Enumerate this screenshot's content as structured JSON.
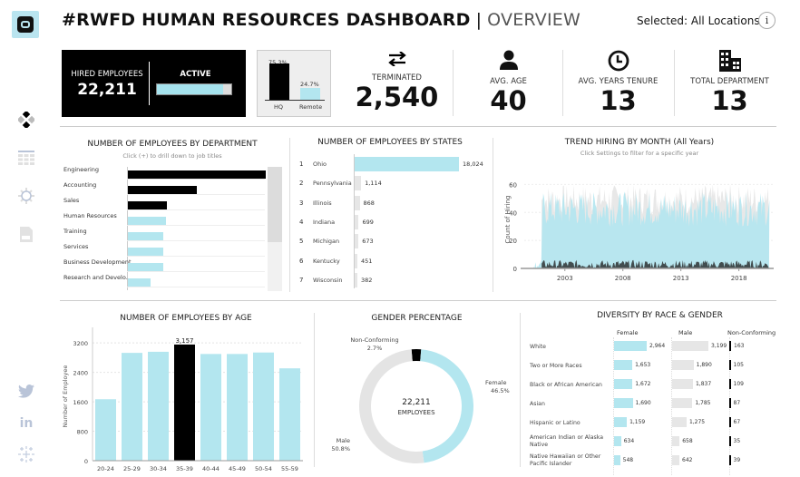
{
  "header": {
    "title": "#RWFD HUMAN RESOURCES DASHBOARD",
    "separator": "|",
    "subtitle": "OVERVIEW",
    "selected": "Selected: All Locations",
    "info_label": "i"
  },
  "sidebar": {
    "logo": "tableau-public-logo-icon",
    "items": [
      {
        "icon": "dashboard-icon",
        "active": true
      },
      {
        "icon": "table-icon",
        "active": false
      },
      {
        "icon": "settings-icon",
        "active": false
      },
      {
        "icon": "pdf-icon",
        "active": false
      }
    ],
    "social": [
      "twitter-icon",
      "linkedin-icon",
      "tableau-icon"
    ]
  },
  "kpis": {
    "hired": {
      "label": "HIRED EMPLOYEES",
      "value": "22,211"
    },
    "active": {
      "label": "ACTIVE",
      "fraction": 0.89
    },
    "location_split": {
      "hq_label": "HQ",
      "hq_pct": "75.3%",
      "hq_value": 75.3,
      "remote_label": "Remote",
      "remote_pct": "24.7%",
      "remote_value": 24.7
    },
    "terminated": {
      "label": "TERMINATED",
      "value": "2,540"
    },
    "avg_age": {
      "label": "AVG. AGE",
      "value": "40"
    },
    "avg_tenure": {
      "label": "AVG. YEARS TENURE",
      "value": "13"
    },
    "total_department": {
      "label": "TOTAL DEPARTMENT",
      "value": "13"
    }
  },
  "colors": {
    "accent": "#b3e6ef",
    "highlight": "#000000",
    "neutral": "#e4e4e4",
    "dark_series": "#3b4446"
  },
  "chart_data": [
    {
      "id": "dept",
      "type": "bar",
      "title": "NUMBER OF EMPLOYEES BY DEPARTMENT",
      "subtitle": "Click (+) to drill down to job titles",
      "categories": [
        "Engineering",
        "Accounting",
        "Sales",
        "Human Resources",
        "Training",
        "Services",
        "Business Development",
        "Research and Develo.."
      ],
      "values": [
        6700,
        3350,
        1900,
        1850,
        1720,
        1720,
        1700,
        1100
      ],
      "highlighted": [
        true,
        true,
        true,
        false,
        false,
        false,
        false,
        false
      ],
      "xlim": [
        0,
        6700
      ]
    },
    {
      "id": "states",
      "type": "bar",
      "title": "NUMBER OF EMPLOYEES BY STATES",
      "ranks": [
        "1",
        "2",
        "3",
        "4",
        "5",
        "6",
        "7"
      ],
      "categories": [
        "Ohio",
        "Pennsylvania",
        "Illinois",
        "Indiana",
        "Michigan",
        "Kentucky",
        "Wisconsin"
      ],
      "values": [
        18024,
        1114,
        868,
        699,
        673,
        451,
        382
      ],
      "labels": [
        "18,024",
        "1,114",
        "868",
        "699",
        "673",
        "451",
        "382"
      ]
    },
    {
      "id": "trend",
      "type": "area",
      "title": "TREND HIRING BY MONTH (All Years)",
      "subtitle": "Click Settings to filter for a specific year",
      "ylabel": "Count of Hiring",
      "xlabel": "",
      "xticks": [
        "2003",
        "2008",
        "2013",
        "2018"
      ],
      "yticks": [
        "0",
        "20",
        "40",
        "60"
      ],
      "ylim": [
        0,
        70
      ],
      "xlim": [
        1999.5,
        2021
      ],
      "series": [
        {
          "name": "Total hires",
          "color": "#e6e6e6",
          "x_start": 2001.0,
          "x_end": 2020.6,
          "typical_range": [
            38,
            60
          ],
          "peak": 68
        },
        {
          "name": "Active hires",
          "color": "#b3e6ef",
          "x_start": 2000.3,
          "x_end": 2020.6,
          "typical_range": [
            30,
            55
          ],
          "peak": 64
        },
        {
          "name": "Terminated hires",
          "color": "#3b4446",
          "x_start": 2001.0,
          "x_end": 2020.6,
          "typical_range": [
            0,
            6
          ],
          "peak": 7
        }
      ]
    },
    {
      "id": "age",
      "type": "bar",
      "title": "NUMBER OF EMPLOYEES BY AGE",
      "ylabel": "Number of Employee",
      "categories": [
        "20-24",
        "25-29",
        "30-34",
        "35-39",
        "40-44",
        "45-49",
        "50-54",
        "55-59"
      ],
      "values": [
        1670,
        2930,
        2960,
        3157,
        2900,
        2900,
        2940,
        2510
      ],
      "highlighted": [
        false,
        false,
        false,
        true,
        false,
        false,
        false,
        false
      ],
      "data_labels": [
        "",
        "",
        "",
        "3,157",
        "",
        "",
        "",
        ""
      ],
      "yticks": [
        "0",
        "800",
        "1600",
        "2400",
        "3200"
      ],
      "ylim": [
        0,
        3500
      ]
    },
    {
      "id": "gender",
      "type": "pie",
      "title": "GENDER PERCENTAGE",
      "center_value": "22,211",
      "center_label": "EMPLOYEES",
      "slices": [
        {
          "name": "Female",
          "value": 46.5,
          "label": "46.5%",
          "color": "#b3e6ef"
        },
        {
          "name": "Male",
          "value": 50.8,
          "label": "50.8%",
          "color": "#e4e4e4"
        },
        {
          "name": "Non-Conforming",
          "value": 2.7,
          "label": "2.7%",
          "color": "#000000"
        }
      ]
    },
    {
      "id": "diversity",
      "type": "table",
      "title": "DIVERSITY BY RACE & GENDER",
      "columns": [
        "Female",
        "Male",
        "Non-Conforming"
      ],
      "rows": [
        {
          "race": "White",
          "female": 2964,
          "male": 3199,
          "nc": 163,
          "female_label": "2,964",
          "male_label": "3,199",
          "nc_label": "163"
        },
        {
          "race": "Two or More Races",
          "female": 1653,
          "male": 1890,
          "nc": 105,
          "female_label": "1,653",
          "male_label": "1,890",
          "nc_label": "105"
        },
        {
          "race": "Black or African American",
          "female": 1672,
          "male": 1837,
          "nc": 109,
          "female_label": "1,672",
          "male_label": "1,837",
          "nc_label": "109"
        },
        {
          "race": "Asian",
          "female": 1690,
          "male": 1785,
          "nc": 87,
          "female_label": "1,690",
          "male_label": "1,785",
          "nc_label": "87"
        },
        {
          "race": "Hispanic or Latino",
          "female": 1159,
          "male": 1275,
          "nc": 67,
          "female_label": "1,159",
          "male_label": "1,275",
          "nc_label": "67"
        },
        {
          "race": "American Indian or Alaska Native",
          "female": 634,
          "male": 658,
          "nc": 35,
          "female_label": "634",
          "male_label": "658",
          "nc_label": "35"
        },
        {
          "race": "Native Hawaiian or Other Pacific Islander",
          "female": 548,
          "male": 642,
          "nc": 39,
          "female_label": "548",
          "male_label": "642",
          "nc_label": "39"
        }
      ]
    }
  ]
}
